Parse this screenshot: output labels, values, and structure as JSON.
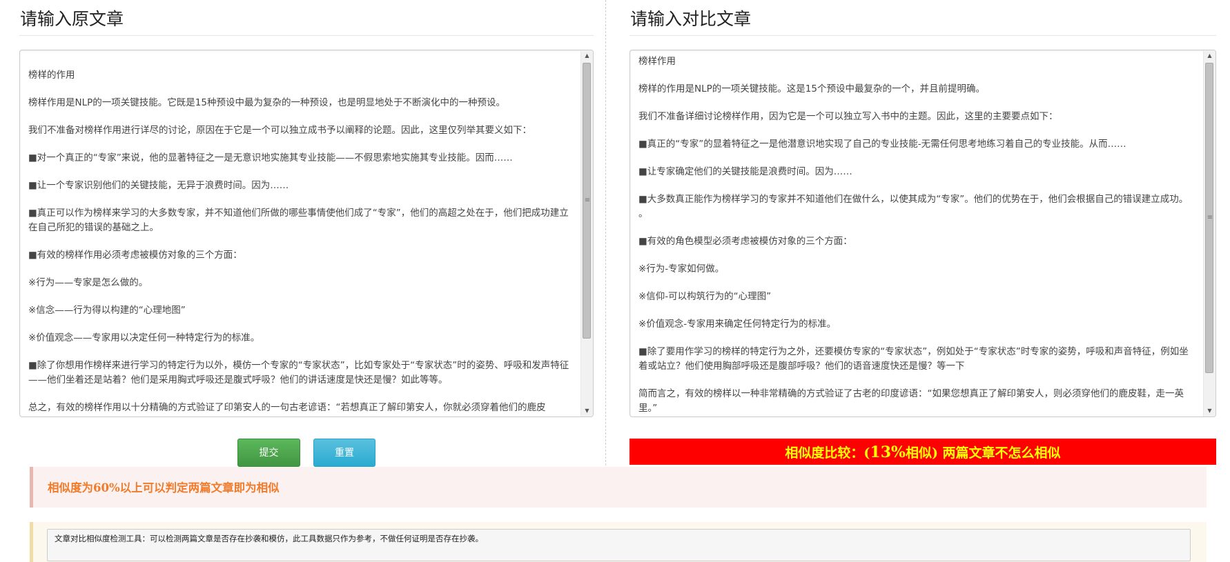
{
  "left_panel": {
    "title": "请输入原文章",
    "paragraphs": [
      "榜样的作用",
      "榜样作用是NLP的一项关键技能。它既是15种预设中最为复杂的一种预设，也是明显地处于不断演化中的一种预设。",
      "我们不准备对榜样作用进行详尽的讨论，原因在于它是一个可以独立成书予以阐释的论题。因此，这里仅列举其要义如下：",
      "■对一个真正的“专家”来说，他的显著特征之一是无意识地实施其专业技能——不假思索地实施其专业技能。因而……",
      "■让一个专家识别他们的关键技能，无异于浪费时间。因为……",
      "■真正可以作为榜样来学习的大多数专家，并不知道他们所做的哪些事情使他们成了“专家”，他们的高超之处在于，他们把成功建立在自己所犯的错误的基础之上。",
      "■有效的榜样作用必须考虑被模仿对象的三个方面：",
      "※行为——专家是怎么做的。",
      "※信念——行为得以构建的“心理地图”",
      "※价值观念——专家用以决定任何一种特定行为的标准。",
      "■除了你想用作榜样来进行学习的特定行为以外，模仿一个专家的“专家状态”，比如专家处于“专家状态”时的姿势、呼吸和发声特征——他们坐着还是站着？他们是采用胸式呼吸还是腹式呼吸？他们的讲话速度是快还是慢？如此等等。",
      "总之，有效的榜样作用以十分精确的方式验证了印第安人的一句古老谚语：“若想真正了解印第安人，你就必须穿着他们的鹿皮"
    ]
  },
  "right_panel": {
    "title": "请输入对比文章",
    "paragraphs": [
      "榜样作用",
      "榜样的作用是NLP的一项关键技能。这是15个预设中最复杂的一个，并且前提明确。",
      "我们不准备详细讨论榜样作用，因为它是一个可以独立写入书中的主题。因此，这里的主要要点如下：",
      "■真正的“专家”的显着特征之一是他潜意识地实现了自己的专业技能-无需任何思考地练习着自己的专业技能。从而……",
      "■让专家确定他们的关键技能是浪费时间。因为……",
      "■大多数真正能作为榜样学习的专家并不知道他们在做什么，以使其成为“专家”。他们的优势在于，他们会根据自己的错误建立成功。 。",
      "■有效的角色模型必须考虑被模仿对象的三个方面：",
      "※行为-专家如何做。",
      "※信仰-可以构筑行为的“心理图”",
      "※价值观念-专家用来确定任何特定行为的标准。",
      "■除了要用作学习的榜样的特定行为之外，还要模仿专家的“专家状态”，例如处于“专家状态”时专家的姿势，呼吸和声音特征，例如坐着或站立？他们使用胸部呼吸还是腹部呼吸？他们的语音速度快还是慢？等一下",
      "简而言之，有效的榜样以一种非常精确的方式验证了古老的印度谚语：“如果您想真正了解印第安人，则必须穿他们的鹿皮鞋，走一英里。”"
    ]
  },
  "buttons": {
    "submit_label": "提交",
    "reset_label": "重置"
  },
  "result": {
    "prefix": "相似度比较：(",
    "percent": "13%",
    "suffix": "相似) 两篇文章不怎么相似",
    "percent_value": 13,
    "background_color": "#ff0000",
    "text_color": "#ffff00"
  },
  "note": {
    "text": "相似度为60%以上可以判定两篇文章即为相似",
    "color": "#f07b2a"
  },
  "description": {
    "text": "文章对比相似度检测工具：可以检测两篇文章是否存在抄袭和模仿，此工具数据只作为参考，不做任何证明是否存在抄袭。"
  },
  "icons": {
    "scroll_up": "scroll-up-arrow-icon",
    "scroll_down": "scroll-down-arrow-icon",
    "grip": "scroll-grip-icon"
  }
}
